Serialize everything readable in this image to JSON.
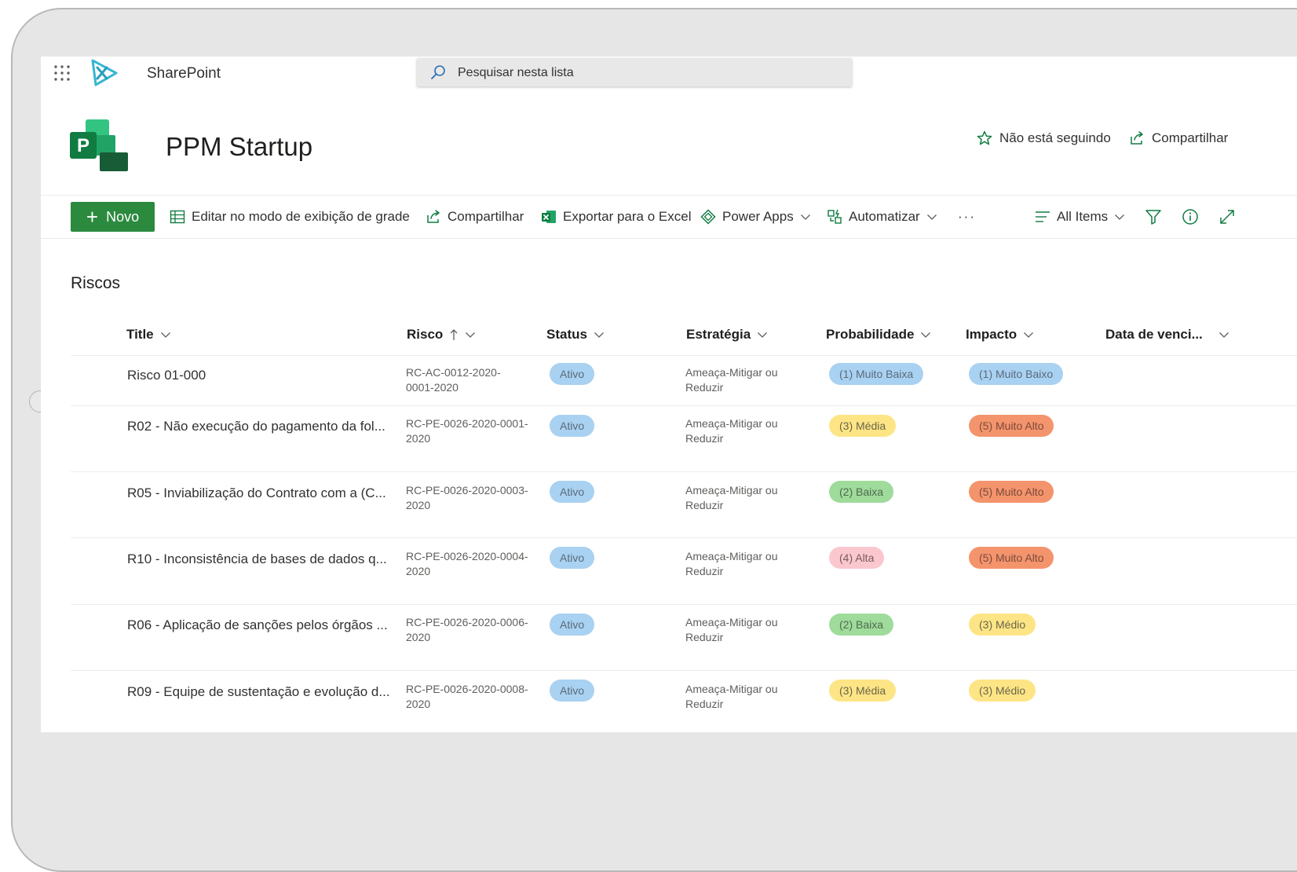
{
  "suite": {
    "app_name": "SharePoint",
    "search_placeholder": "Pesquisar nesta lista"
  },
  "site": {
    "title": "PPM Startup",
    "follow_label": "Não está seguindo",
    "share_label": "Compartilhar",
    "logo_letter": "P"
  },
  "commands": {
    "new": "Novo",
    "grid_edit": "Editar no modo de exibição de grade",
    "share": "Compartilhar",
    "export": "Exportar para o Excel",
    "power_apps": "Power Apps",
    "automate": "Automatizar",
    "more": "···",
    "view": "All Items"
  },
  "list": {
    "title": "Riscos",
    "columns": [
      "Title",
      "Risco",
      "Status",
      "Estratégia",
      "Probabilidade",
      "Impacto",
      "Data de venci..."
    ],
    "rows": [
      {
        "title": "Risco 01-000",
        "risco_1": "RC-AC-0012-2020-",
        "risco_2": "0001-2020",
        "status": "Ativo",
        "estrategia_1": "Ameaça-Mitigar ou",
        "estrategia_2": "Reduzir",
        "probabilidade": "(1) Muito Baixa",
        "impacto": "(1) Muito Baixo"
      },
      {
        "title": "R02 - Não execução do pagamento da fol...",
        "risco_1": "RC-PE-0026-2020-0001-",
        "risco_2": "2020",
        "status": "Ativo",
        "estrategia_1": "Ameaça-Mitigar ou",
        "estrategia_2": "Reduzir",
        "probabilidade": "(3) Média",
        "impacto": "(5) Muito Alto"
      },
      {
        "title": "R05 - Inviabilização do Contrato com a (C...",
        "risco_1": "RC-PE-0026-2020-0003-",
        "risco_2": "2020",
        "status": "Ativo",
        "estrategia_1": "Ameaça-Mitigar ou",
        "estrategia_2": "Reduzir",
        "probabilidade": "(2) Baixa",
        "impacto": "(5) Muito Alto"
      },
      {
        "title": "R10 - Inconsistência de bases de dados q...",
        "risco_1": "RC-PE-0026-2020-0004-",
        "risco_2": "2020",
        "status": "Ativo",
        "estrategia_1": "Ameaça-Mitigar ou",
        "estrategia_2": "Reduzir",
        "probabilidade": "(4) Alta",
        "impacto": "(5) Muito Alto"
      },
      {
        "title": "R06 - Aplicação de sanções pelos órgãos ...",
        "risco_1": "RC-PE-0026-2020-0006-",
        "risco_2": "2020",
        "status": "Ativo",
        "estrategia_1": "Ameaça-Mitigar ou",
        "estrategia_2": "Reduzir",
        "probabilidade": "(2) Baixa",
        "impacto": "(3) Médio"
      },
      {
        "title": "R09 - Equipe de sustentação e evolução d...",
        "risco_1": "RC-PE-0026-2020-0008-",
        "risco_2": "2020",
        "status": "Ativo",
        "estrategia_1": "Ameaça-Mitigar ou",
        "estrategia_2": "Reduzir",
        "probabilidade": "(3) Média",
        "impacto": "(3) Médio"
      }
    ]
  },
  "colors": {
    "primary_button": "#2b8a3e",
    "link_blue": "#0078d4",
    "excel_green": "#1d6f42"
  }
}
